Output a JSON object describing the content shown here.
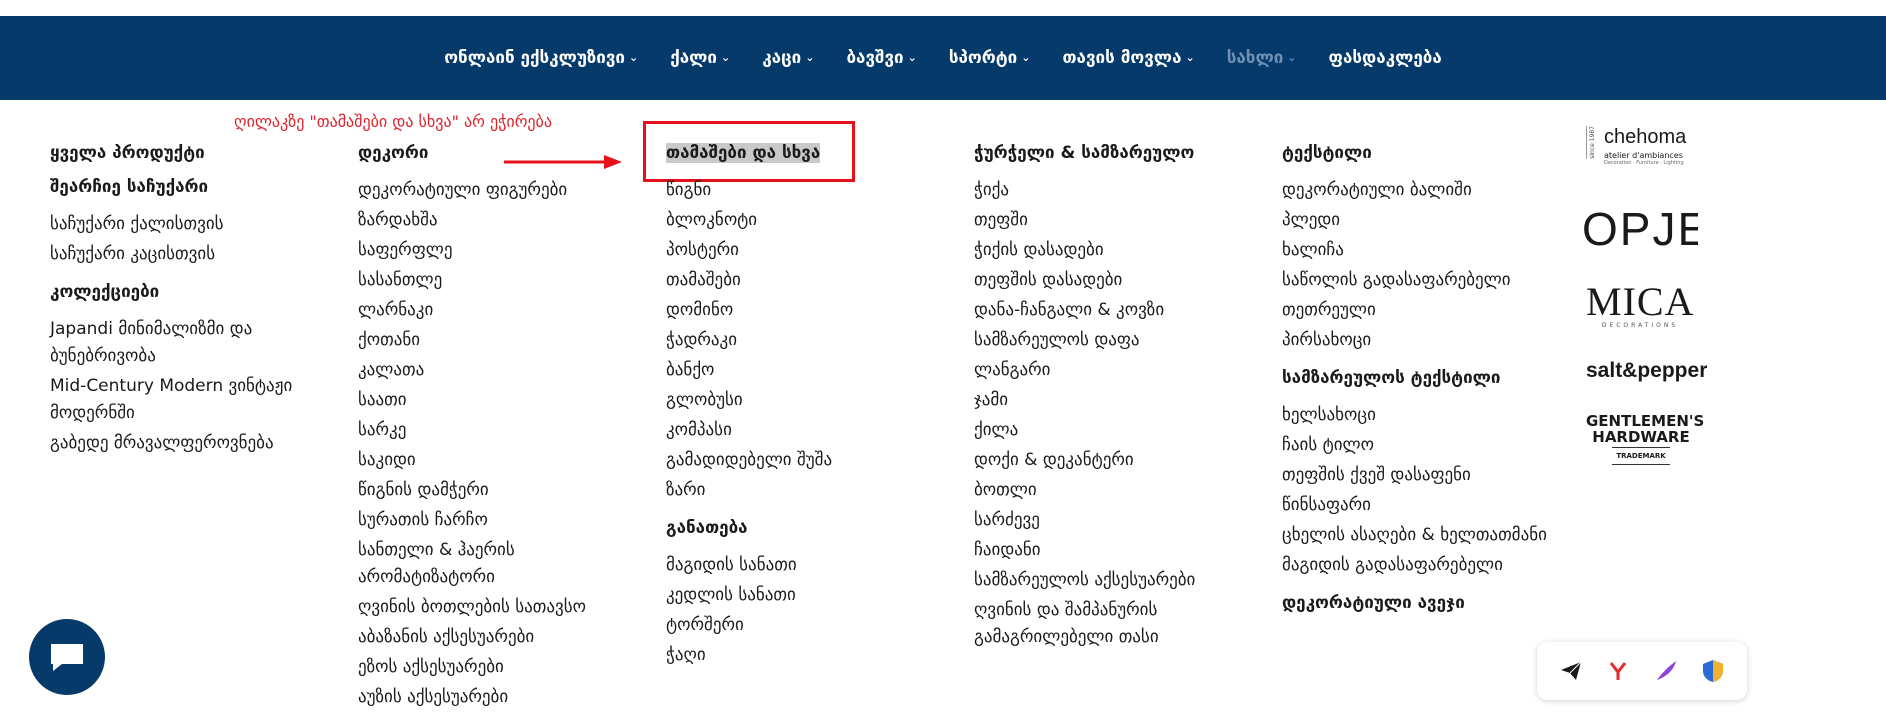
{
  "nav": {
    "items": [
      {
        "label": "ონლაინ ექსკლუზივი",
        "active": false
      },
      {
        "label": "ქალი",
        "active": false
      },
      {
        "label": "კაცი",
        "active": false
      },
      {
        "label": "ბავშვი",
        "active": false
      },
      {
        "label": "სპორტი",
        "active": false
      },
      {
        "label": "თავის მოვლა",
        "active": false
      },
      {
        "label": "სახლი",
        "active": true
      },
      {
        "label": "ფასდაკლება",
        "active": false
      }
    ]
  },
  "annotation": {
    "text": "ღილაკზე \"თამაშები და სხვა\" არ ეჭირება"
  },
  "columns": {
    "col1": {
      "head": "ყველა პროდუქტი",
      "gift_head": "შეარჩიე საჩუქარი",
      "gift_links": [
        "საჩუქარი ქალისთვის",
        "საჩუქარი კაცისთვის"
      ],
      "collections_head": "კოლექციები",
      "collection_links": [
        "Japandi მინიმალიზმი და ბუნებრივობა",
        "Mid-Century Modern ვინტაჟი მოდერნში",
        "გაბედე მრავალფეროვნება"
      ]
    },
    "col2": {
      "head": "დეკორი",
      "links": [
        "დეკორატიული ფიგურები",
        "ზარდახშა",
        "საფერფლე",
        "სასანთლე",
        "ლარნაკი",
        "ქოთანი",
        "კალათა",
        "საათი",
        "სარკე",
        "საკიდი",
        "წიგნის დამჭერი",
        "სურათის ჩარჩო",
        "სანთელი & ჰაერის არომატიზატორი",
        "ღვინის ბოთლების სათავსო",
        "აბაზანის აქსესუარები",
        "ეზოს აქსესუარები",
        "აუზის აქსესუარები"
      ]
    },
    "col3": {
      "head": "თამაშები და სხვა",
      "links": [
        "წიგნი",
        "ბლოკნოტი",
        "პოსტერი",
        "თამაშები",
        "დომინო",
        "ჭადრაკი",
        "ბანქო",
        "გლობუსი",
        "კომპასი",
        "გამადიდებელი შუშა",
        "ზარი"
      ],
      "lighting_head": "განათება",
      "lighting_links": [
        "მაგიდის სანათი",
        "კედლის სანათი",
        "ტორშერი",
        "ჭაღი"
      ]
    },
    "col4": {
      "head": "ჭურჭელი & სამზარეულო",
      "links": [
        "ჭიქა",
        "თეფში",
        "ჭიქის დასადები",
        "თეფშის დასადები",
        "დანა-ჩანგალი & კოვზი",
        "სამზარეულოს დაფა",
        "ლანგარი",
        "ჯამი",
        "ქილა",
        "დოქი & დეკანტერი",
        "ბოთლი",
        "სარძევე",
        "ჩაიდანი",
        "სამზარეულოს აქსესუარები",
        "ღვინის და შამპანურის გამაგრილებელი თასი"
      ]
    },
    "col5": {
      "head": "ტექსტილი",
      "links": [
        "დეკორატიული ბალიში",
        "პლედი",
        "ხალიჩა",
        "საწოლის გადასაფარებელი",
        "თეთრეული",
        "პირსახოცი"
      ],
      "kitchen_head": "სამზარეულოს ტექსტილი",
      "kitchen_links": [
        "ხელსახოცი",
        "ჩაის ტილო",
        "თეფშის ქვეშ დასაფენი",
        "წინსაფარი",
        "ცხელის ასაღები & ხელთათმანი",
        "მაგიდის გადასაფარებელი"
      ],
      "decor_head": "დეკორატიული ავეჯი"
    }
  },
  "brands": {
    "chehoma": {
      "name": "chehoma",
      "side": "since 1987",
      "sub": "atelier d'ambiances",
      "tiny": "Decoration · Furniture · Lighting"
    },
    "opjet": {
      "name": "OPJET"
    },
    "mica": {
      "name": "MICA",
      "sub": "DECORATIONS"
    },
    "saltpepper": {
      "name": "salt&pepper"
    },
    "gentlemen": {
      "line1": "GENTLEMEN'S",
      "line2": "HARDWARE",
      "tm": "TRADEMARK"
    }
  },
  "colors": {
    "navbar": "#063a6a",
    "annotation": "#e0202a",
    "highlight_bg": "#c9c9c9"
  },
  "icons": [
    "chevron-down-icon",
    "arrow-icon",
    "chat-icon",
    "send-icon",
    "yandex-icon",
    "feather-icon",
    "shield-icon"
  ]
}
